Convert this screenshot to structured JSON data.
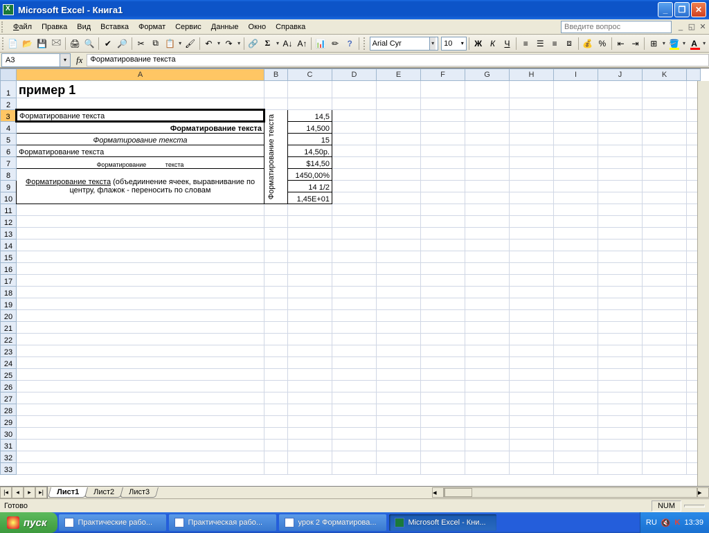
{
  "window": {
    "title": "Microsoft Excel - Книга1"
  },
  "menu": {
    "file": "Файл",
    "edit": "Правка",
    "view": "Вид",
    "insert": "Вставка",
    "format": "Формат",
    "tools": "Сервис",
    "data": "Данные",
    "window": "Окно",
    "help": "Справка"
  },
  "question_placeholder": "Введите вопрос",
  "formatting": {
    "font": "Arial Cyr",
    "size": "10"
  },
  "formula": {
    "cellref": "A3",
    "fx": "fx",
    "value": "Форматирование текста"
  },
  "columns": [
    "A",
    "B",
    "C",
    "D",
    "E",
    "F",
    "G",
    "H",
    "I",
    "J",
    "K"
  ],
  "rows": [
    "1",
    "2",
    "3",
    "4",
    "5",
    "6",
    "7",
    "8",
    "9",
    "10",
    "11",
    "12",
    "13",
    "14",
    "15",
    "16",
    "17",
    "18",
    "19",
    "20",
    "21",
    "22",
    "23",
    "24",
    "25",
    "26",
    "27",
    "28",
    "29",
    "30",
    "31",
    "32",
    "33"
  ],
  "cells": {
    "A1": "пример 1",
    "A3": "Форматирование текста",
    "A4": "Форматирование текста",
    "A5": "Форматирование текста",
    "A6": "Форматирование текста",
    "A7": "Форматирование           текста",
    "A8": "Форматирование текста",
    "A8suffix": " (объедиинение ячеек, выравнивание по центру, флажок - переносить по словам",
    "B3": "Форматирование текста",
    "C3": "14,5",
    "C4": "14,500",
    "C5": "15",
    "C6": "14,50р.",
    "C7": "$14,50",
    "C8": "1450,00%",
    "C9": "14 1/2",
    "C10": "1,45E+01"
  },
  "sheets": {
    "s1": "Лист1",
    "s2": "Лист2",
    "s3": "Лист3"
  },
  "status": {
    "ready": "Готово",
    "num": "NUM"
  },
  "taskbar": {
    "start": "пуск",
    "t1": "Практические рабо...",
    "t2": "Практическая рабо...",
    "t3": "урок 2 Форматирова...",
    "t4": "Microsoft Excel - Кни...",
    "lang": "RU",
    "clock": "13:39"
  }
}
